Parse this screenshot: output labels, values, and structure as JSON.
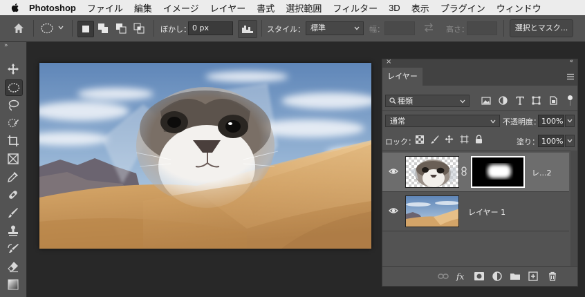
{
  "menubar": {
    "app_name": "Photoshop",
    "items": [
      "ファイル",
      "編集",
      "イメージ",
      "レイヤー",
      "書式",
      "選択範囲",
      "フィルター",
      "3D",
      "表示",
      "プラグイン",
      "ウィンドウ"
    ]
  },
  "options_bar": {
    "feather_label": "ぼかし：",
    "feather_value": "0 px",
    "style_label": "スタイル：",
    "style_value": "標準",
    "width_label": "幅：",
    "height_label": "高さ：",
    "select_mask_button": "選択とマスク..."
  },
  "toolbar": {
    "collapse": "»",
    "tools": [
      "move-tool",
      "elliptical-marquee-tool",
      "lasso-tool",
      "quick-selection-tool",
      "crop-tool",
      "frame-tool",
      "eyedropper-tool",
      "healing-brush-tool",
      "brush-tool",
      "clone-stamp-tool",
      "history-brush-tool",
      "eraser-tool",
      "gradient-tool"
    ],
    "active_tool": "elliptical-marquee-tool"
  },
  "layers_panel": {
    "close": "×",
    "collapse": "«",
    "tab_label": "レイヤー",
    "filter_label": "種類",
    "blend_mode": "通常",
    "opacity_label": "不透明度：",
    "opacity_value": "100%",
    "lock_label": "ロック：",
    "fill_label": "塗り：",
    "fill_value": "100%",
    "layers": [
      {
        "name": "レ...2",
        "visible": true,
        "selected": true,
        "has_mask": true
      },
      {
        "name": "レイヤー 1",
        "visible": true,
        "selected": false,
        "has_mask": false
      }
    ]
  },
  "colors": {
    "menubar_bg": "#ececec",
    "ui_bg": "#535353",
    "workspace_bg": "#282828",
    "selected_layer": "#6d6d6d"
  }
}
